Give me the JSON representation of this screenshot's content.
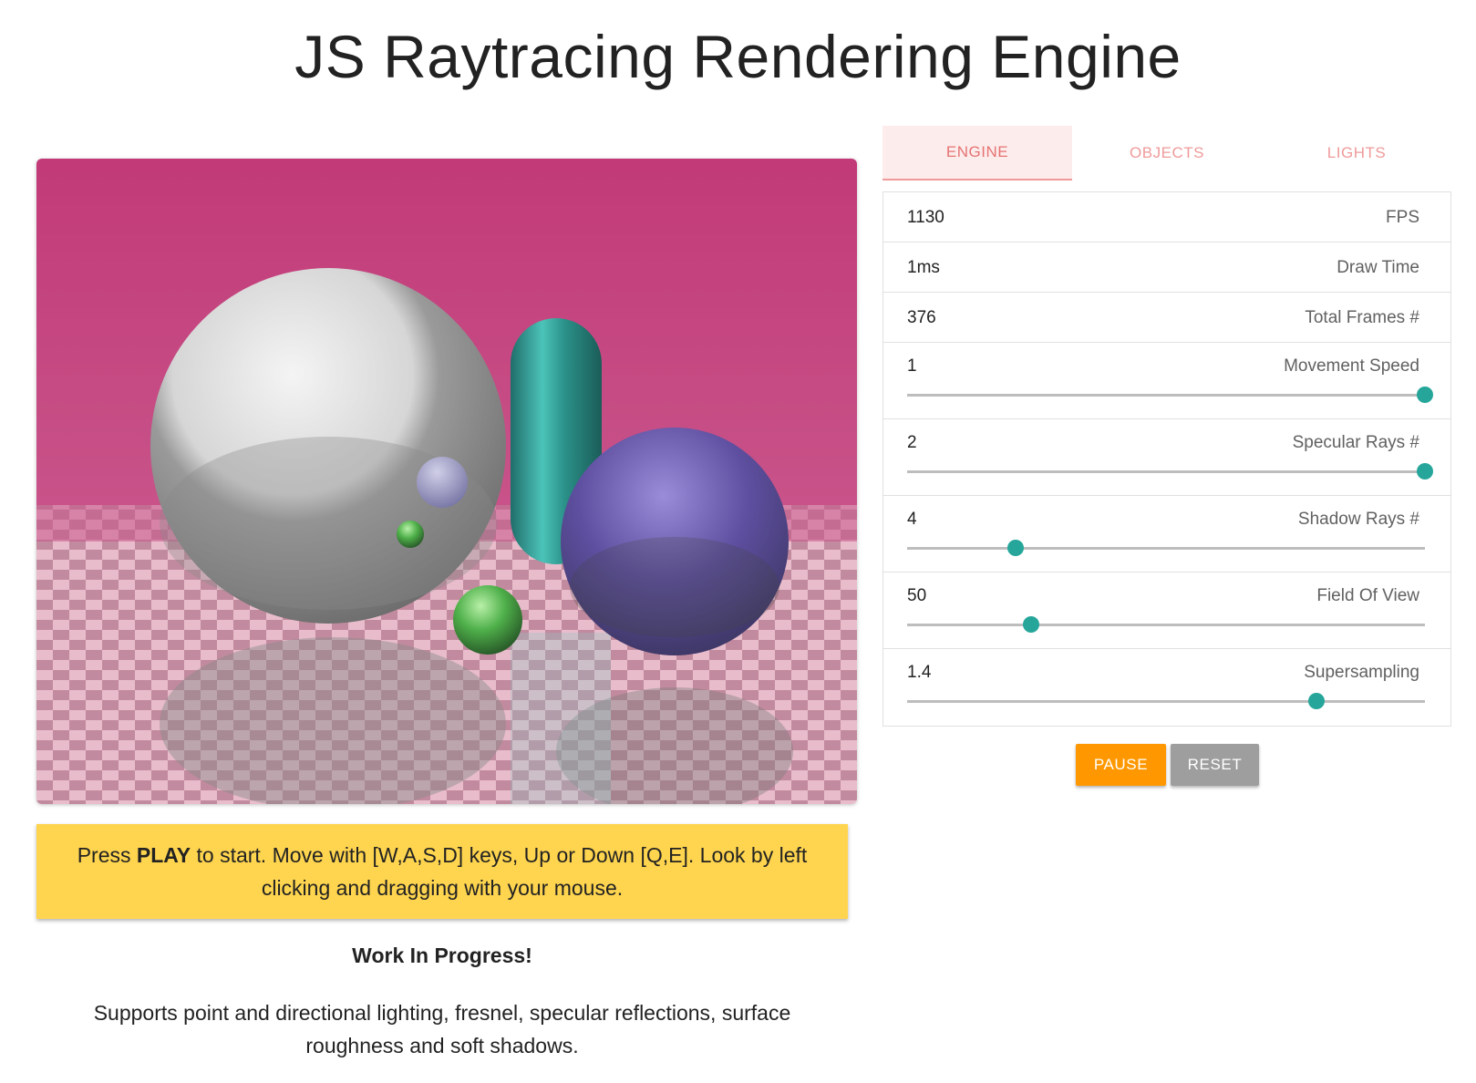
{
  "page_title": "JS Raytracing Rendering Engine",
  "tabs": [
    {
      "label": "ENGINE",
      "active": true
    },
    {
      "label": "OBJECTS",
      "active": false
    },
    {
      "label": "LIGHTS",
      "active": false
    }
  ],
  "stats": {
    "fps": {
      "value": "1130",
      "label": "FPS"
    },
    "draw_time": {
      "value": "1ms",
      "label": "Draw Time"
    },
    "total_frames": {
      "value": "376",
      "label": "Total Frames #"
    }
  },
  "sliders": {
    "movement_speed": {
      "value": "1",
      "label": "Movement Speed",
      "fill": 1.0
    },
    "specular_rays": {
      "value": "2",
      "label": "Specular Rays #",
      "fill": 1.0
    },
    "shadow_rays": {
      "value": "4",
      "label": "Shadow Rays #",
      "fill": 0.21
    },
    "field_of_view": {
      "value": "50",
      "label": "Field Of View",
      "fill": 0.24
    },
    "supersampling": {
      "value": "1.4",
      "label": "Supersampling",
      "fill": 0.79
    }
  },
  "buttons": {
    "pause": "PAUSE",
    "reset": "RESET"
  },
  "hint": {
    "prefix": "Press ",
    "bold": "PLAY",
    "suffix": " to start. Move with [W,A,S,D] keys, Up or Down [Q,E]. Look by left clicking and dragging with your mouse."
  },
  "wip": "Work In Progress!",
  "description": "Supports point and directional lighting, fresnel, specular reflections, surface roughness and soft shadows.",
  "colors": {
    "accent_teal": "#26a69a",
    "pause_orange": "#ff9800",
    "reset_grey": "#9e9e9e",
    "hint_yellow": "#ffd54f",
    "tab_pink": "#ef9a9a",
    "scene_backdrop": "#c2407c"
  }
}
